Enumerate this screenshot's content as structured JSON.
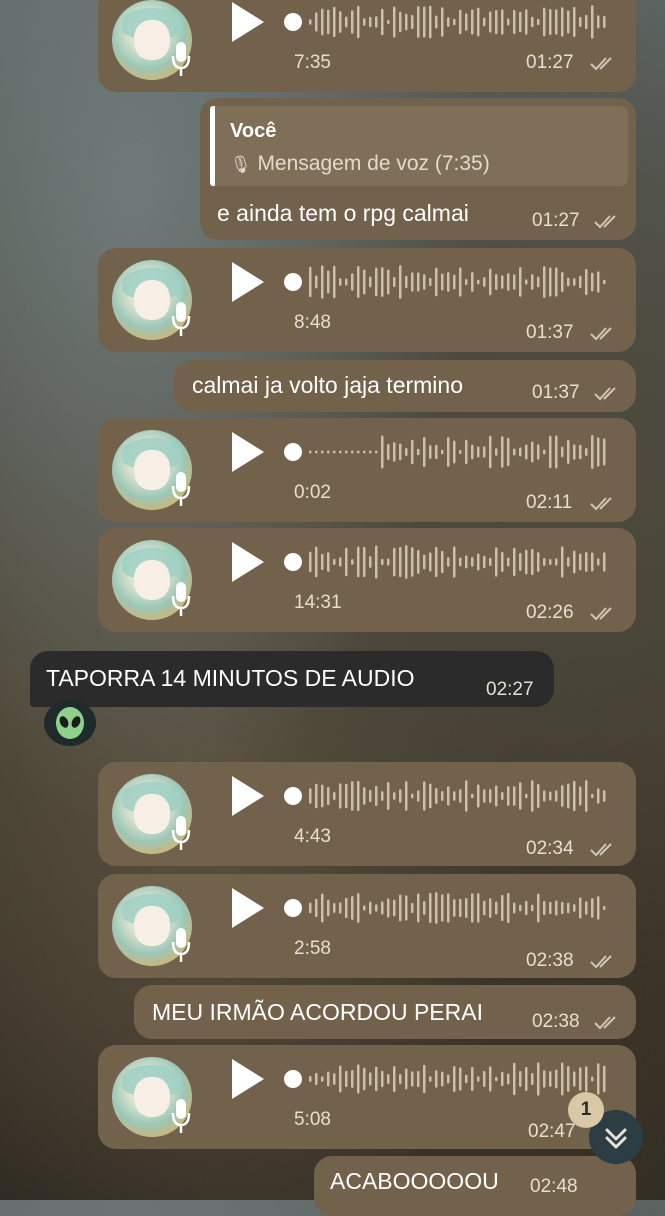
{
  "colors": {
    "outgoing_bubble": "#73624b",
    "incoming_bubble": "#2b2b2b",
    "accent": "#e7ded0"
  },
  "voice_messages": [
    {
      "duration": "7:35",
      "time": "01:27"
    },
    {
      "duration": "8:48",
      "time": "01:37"
    },
    {
      "duration": "0:02",
      "time": "02:11"
    },
    {
      "duration": "14:31",
      "time": "02:26"
    },
    {
      "duration": "4:43",
      "time": "02:34"
    },
    {
      "duration": "2:58",
      "time": "02:38"
    },
    {
      "duration": "5:08",
      "time": "02:47"
    }
  ],
  "reply": {
    "author": "Você",
    "quoted": "Mensagem de voz (7:35)",
    "text": "e ainda tem o rpg calmai",
    "time": "01:27"
  },
  "text_messages": [
    {
      "text": "calmai ja volto jaja termino",
      "time": "01:37"
    },
    {
      "text": "TAPORRA 14 MINUTOS DE AUDIO",
      "time": "02:27"
    },
    {
      "text": "MEU IRMÃO ACORDOU PERAI",
      "time": "02:38"
    },
    {
      "text": "ACABOOOOOU",
      "time": "02:48"
    }
  ],
  "icons": {
    "play": "play-icon",
    "mic": "microphone-icon",
    "read": "double-check-icon",
    "reaction": "alien-emoji",
    "scroll": "double-chevron-down-icon"
  },
  "unread_badge": "1"
}
